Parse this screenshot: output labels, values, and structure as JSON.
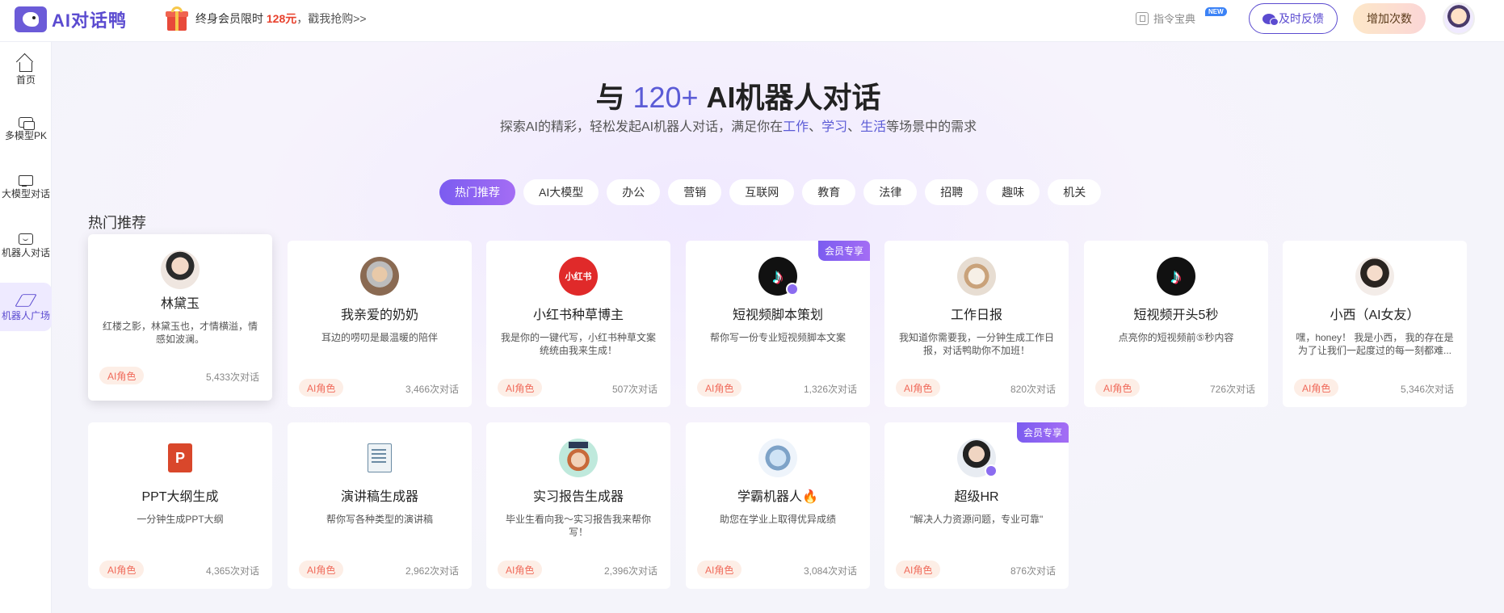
{
  "header": {
    "logo_text": "AI对话鸭",
    "promo_prefix": "终身会员限时 ",
    "promo_price": "128元",
    "promo_suffix": "，戳我抢购>>",
    "guide_label": "指令宝典",
    "new_badge": "NEW",
    "feedback_label": "及时反馈",
    "add_label": "增加次数"
  },
  "sidebar": {
    "items": [
      {
        "label": "首页",
        "icon": "home-icon"
      },
      {
        "label": "多模型PK",
        "icon": "chat-bubbles-icon"
      },
      {
        "label": "大模型对话",
        "icon": "screen-icon"
      },
      {
        "label": "机器人对话",
        "icon": "bot-chat-icon"
      },
      {
        "label": "机器人广场",
        "icon": "cube-icon"
      }
    ]
  },
  "hero": {
    "title_pre": "与 ",
    "title_hl": "120+",
    "title_post": " AI机器人对话",
    "sub_pre": "探索AI的精彩，轻松发起AI机器人对话，满足你在",
    "kw1": "工作",
    "sep1": "、",
    "kw2": "学习",
    "sep2": "、",
    "kw3": "生活",
    "sub_post": "等场景中的需求"
  },
  "categories": [
    "热门推荐",
    "AI大模型",
    "办公",
    "营销",
    "互联网",
    "教育",
    "法律",
    "招聘",
    "趣味",
    "机关"
  ],
  "section_title": "热门推荐",
  "cards": [
    {
      "name": "林黛玉",
      "desc": "红楼之影，林黛玉也，才情横溢，情感如波澜。",
      "tag": "AI角色",
      "count": "5,433次对话"
    },
    {
      "name": "我亲爱的奶奶",
      "desc": "耳边的唠叨是最温暖的陪伴",
      "tag": "AI角色",
      "count": "3,466次对话"
    },
    {
      "name": "小红书种草博主",
      "desc": "我是你的一键代写，小红书种草文案统统由我来生成！",
      "tag": "AI角色",
      "count": "507次对话",
      "avatar_text": "小红书"
    },
    {
      "name": "短视频脚本策划",
      "desc": "帮你写一份专业短视频脚本文案",
      "tag": "AI角色",
      "count": "1,326次对话",
      "vip": "会员专享"
    },
    {
      "name": "工作日报",
      "desc": "我知道你需要我，一分钟生成工作日报，对话鸭助你不加班！",
      "tag": "AI角色",
      "count": "820次对话"
    },
    {
      "name": "短视频开头5秒",
      "desc": "点亮你的短视频前⑤秒内容",
      "tag": "AI角色",
      "count": "726次对话"
    },
    {
      "name": "小西（AI女友）",
      "desc": "嘿，honey！ 我是小西， 我的存在是为了让我们一起度过的每一刻都难...",
      "tag": "AI角色",
      "count": "5,346次对话"
    },
    {
      "name": "PPT大纲生成",
      "desc": "一分钟生成PPT大纲",
      "tag": "AI角色",
      "count": "4,365次对话",
      "avatar_text": "P"
    },
    {
      "name": "演讲稿生成器",
      "desc": "帮你写各种类型的演讲稿",
      "tag": "AI角色",
      "count": "2,962次对话"
    },
    {
      "name": "实习报告生成器",
      "desc": "毕业生看向我～实习报告我来帮你写！",
      "tag": "AI角色",
      "count": "2,396次对话"
    },
    {
      "name": "学霸机器人🔥",
      "desc": "助您在学业上取得优异成绩",
      "tag": "AI角色",
      "count": "3,084次对话"
    },
    {
      "name": "超级HR",
      "desc": "\"解决人力资源问题，专业可靠\"",
      "tag": "AI角色",
      "count": "876次对话",
      "vip": "会员专享"
    }
  ]
}
